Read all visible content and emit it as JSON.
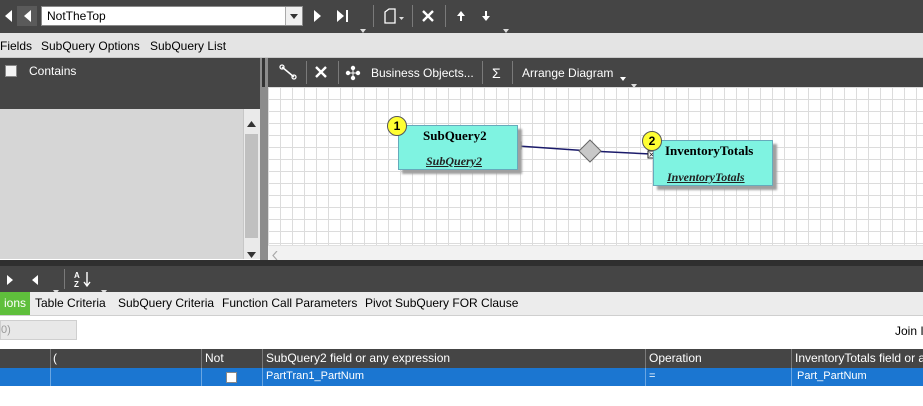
{
  "nav": {
    "combo_value": "NotTheTop"
  },
  "menu": {
    "items": [
      "Fields",
      "SubQuery Options",
      "SubQuery List"
    ]
  },
  "left_panel": {
    "contains_label": "Contains"
  },
  "diagram_toolbar": {
    "business_objects": "Business Objects...",
    "sigma": "Σ",
    "arrange": "Arrange Diagram"
  },
  "diagram": {
    "tables": [
      {
        "badge": "1",
        "title": "SubQuery2",
        "subtitle": "SubQuery2"
      },
      {
        "badge": "2",
        "title": "InventoryTotals",
        "subtitle": "InventoryTotals"
      }
    ]
  },
  "tabs": {
    "active": "ions",
    "items": [
      "Table Criteria",
      "SubQuery Criteria",
      "Function Call Parameters",
      "Pivot SubQuery FOR Clause"
    ]
  },
  "filter": {
    "value": "0)",
    "join_label": "Join I"
  },
  "grid": {
    "headers": [
      "(",
      "Not",
      "SubQuery2 field or any expression",
      "Operation",
      "InventoryTotals field or a"
    ],
    "rows": [
      {
        "field": "PartTran1_PartNum",
        "operation": "=",
        "right_field": "Part_PartNum"
      }
    ]
  },
  "colors": {
    "toolbar": "#454545",
    "table_fill": "#7ff3e1",
    "badge_fill": "#ffff33",
    "active_tab": "#5fbf3c",
    "selected_row": "#1b76d1"
  }
}
